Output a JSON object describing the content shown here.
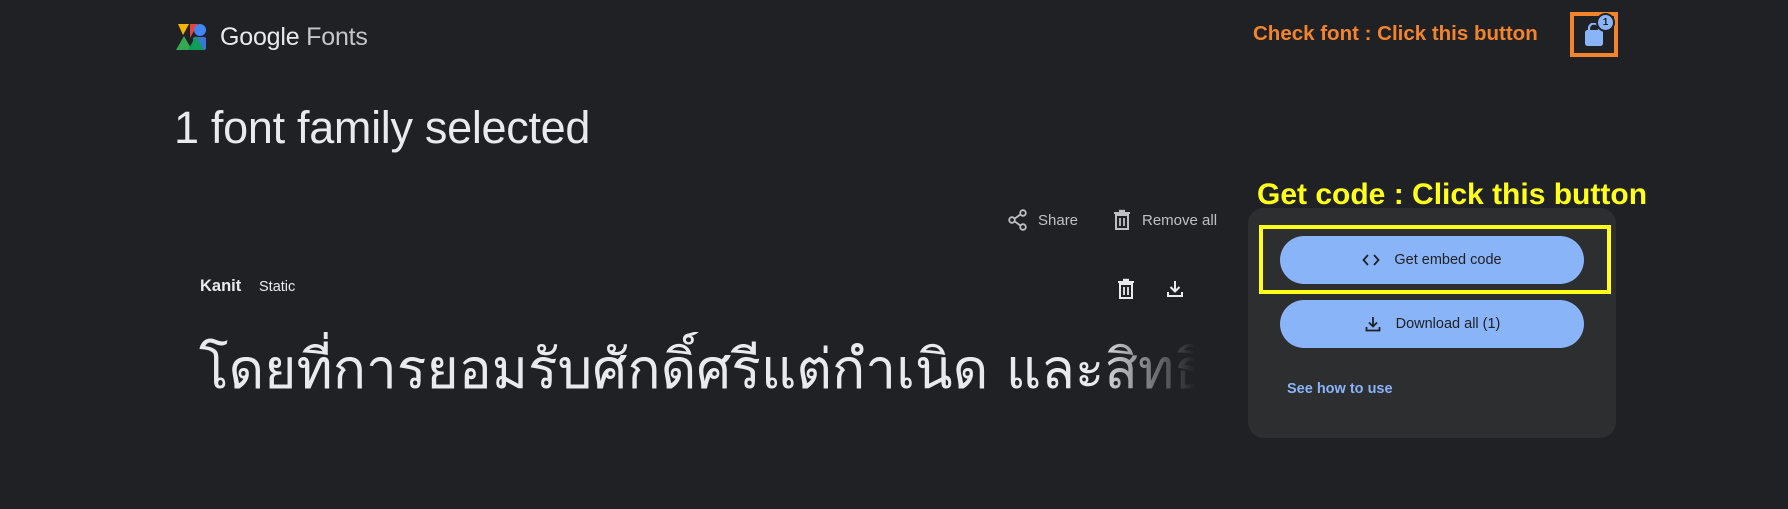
{
  "header": {
    "logo_text_1": "Google",
    "logo_text_2": " Fonts",
    "annotation_check_font": "Check font : Click this button",
    "cart_count": "1"
  },
  "page_title": "1 font family selected",
  "actions": {
    "share_label": "Share",
    "remove_all_label": "Remove all"
  },
  "font_card": {
    "name": "Kanit",
    "style": "Static",
    "sample_text": "โดยที่การยอมรับศักดิ์ศรีแต่กำเนิด และสิทธิที่"
  },
  "panel": {
    "annotation_get_code": "Get code : Click this button",
    "embed_label": "Get embed code",
    "download_all_label": "Download all (1)",
    "see_how_label": "See how to use"
  },
  "colors": {
    "background": "#202124",
    "panel": "#2d2e30",
    "accent_blue": "#8ab4f8",
    "annotation_orange": "#f4842b",
    "annotation_yellow": "#ffff1a"
  },
  "icons": [
    "google-fonts-logo",
    "shopping-bag-icon",
    "share-icon",
    "trash-icon",
    "download-icon",
    "code-icon"
  ]
}
